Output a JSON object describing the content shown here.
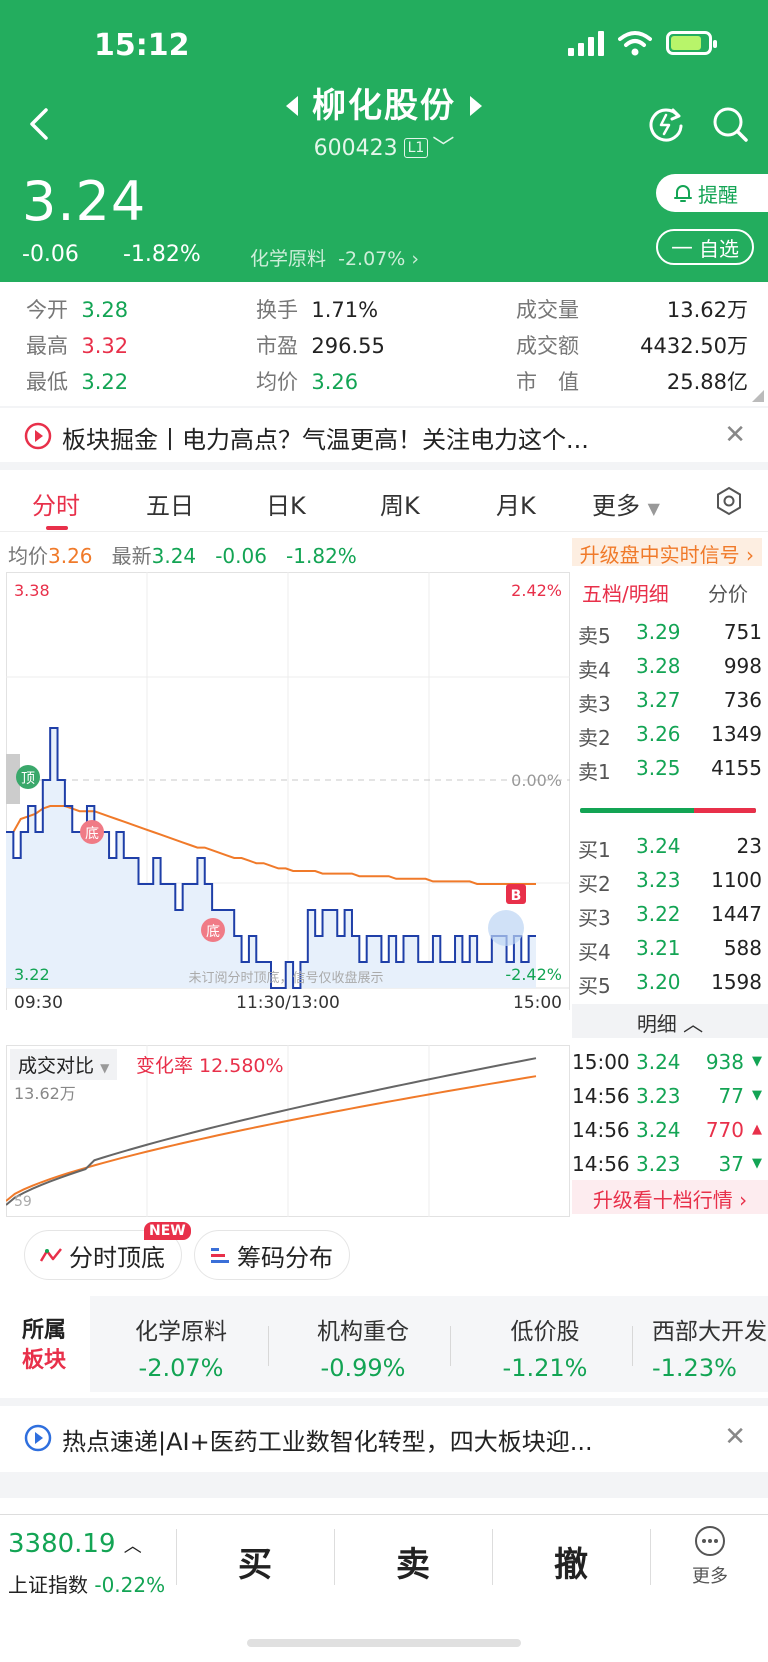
{
  "status": {
    "time": "15:12"
  },
  "header": {
    "stock_name": "柳化股份",
    "stock_code": "600423",
    "level": "L1",
    "price": "3.24",
    "change": "-0.06",
    "change_pct": "-1.82%",
    "sector_name": "化学原料",
    "sector_pct": "-2.07%",
    "alert_label": "提醒",
    "watch_label": "自选",
    "brand_color": "#23ad5e"
  },
  "stats": [
    {
      "label": "今开",
      "value": "3.28",
      "tone": "green"
    },
    {
      "label": "换手",
      "value": "1.71%",
      "tone": "black"
    },
    {
      "label": "成交量",
      "value": "13.62万",
      "tone": "black"
    },
    {
      "label": "最高",
      "value": "3.32",
      "tone": "red"
    },
    {
      "label": "市盈",
      "value": "296.55",
      "tone": "black"
    },
    {
      "label": "成交额",
      "value": "4432.50万",
      "tone": "black"
    },
    {
      "label": "最低",
      "value": "3.22",
      "tone": "green"
    },
    {
      "label": "均价",
      "value": "3.26",
      "tone": "green"
    },
    {
      "label": "市　值",
      "value": "25.88亿",
      "tone": "black"
    }
  ],
  "news1": "板块掘金丨电力高点？气温更高！关注电力这个...",
  "tabs": [
    "分时",
    "五日",
    "日K",
    "周K",
    "月K",
    "更多"
  ],
  "summary": {
    "avg_label": "均价",
    "avg_value": "3.26",
    "latest_label": "最新",
    "latest_value": "3.24",
    "change": "-0.06",
    "change_pct": "-1.82%",
    "upgrade": "升级盘中实时信号"
  },
  "chart": {
    "high_price": "3.38",
    "low_price": "3.22",
    "high_pct": "2.42%",
    "low_pct": "-2.42%",
    "zero_pct": "0.00%",
    "time_labels": [
      "09:30",
      "11:30/13:00",
      "15:00"
    ],
    "watermark": "未订阅分时顶底，信号仅收盘展示",
    "top_marker": "顶",
    "bottom_marker": "底",
    "buy_marker": "B"
  },
  "chart_data": {
    "type": "line",
    "ylim": [
      3.22,
      3.38
    ],
    "x": [
      "09:30",
      "11:30/13:00",
      "15:00"
    ],
    "series": [
      {
        "name": "价格",
        "values": [
          3.28,
          3.27,
          3.28,
          3.29,
          3.28,
          3.3,
          3.32,
          3.3,
          3.29,
          3.28,
          3.28,
          3.29,
          3.28,
          3.28,
          3.27,
          3.28,
          3.27,
          3.27,
          3.26,
          3.26,
          3.27,
          3.26,
          3.26,
          3.25,
          3.26,
          3.26,
          3.27,
          3.26,
          3.25,
          3.25,
          3.25,
          3.24,
          3.23,
          3.24,
          3.23,
          3.23,
          3.22,
          3.22,
          3.23,
          3.22,
          3.23,
          3.25,
          3.24,
          3.25,
          3.25,
          3.24,
          3.25,
          3.24,
          3.23,
          3.24,
          3.24,
          3.23,
          3.24,
          3.23,
          3.24,
          3.24,
          3.23,
          3.23,
          3.24,
          3.23,
          3.23,
          3.24,
          3.23,
          3.24,
          3.23,
          3.23,
          3.24,
          3.24,
          3.23,
          3.24,
          3.23,
          3.24,
          3.24
        ]
      },
      {
        "name": "均价",
        "values": [
          3.28,
          3.28,
          3.285,
          3.286,
          3.287,
          3.289,
          3.29,
          3.29,
          3.29,
          3.289,
          3.288,
          3.288,
          3.288,
          3.287,
          3.286,
          3.285,
          3.284,
          3.283,
          3.282,
          3.281,
          3.28,
          3.279,
          3.278,
          3.277,
          3.276,
          3.275,
          3.274,
          3.274,
          3.273,
          3.272,
          3.271,
          3.27,
          3.27,
          3.269,
          3.268,
          3.268,
          3.267,
          3.266,
          3.266,
          3.265,
          3.265,
          3.265,
          3.265,
          3.264,
          3.264,
          3.264,
          3.264,
          3.264,
          3.263,
          3.263,
          3.263,
          3.263,
          3.263,
          3.262,
          3.262,
          3.262,
          3.262,
          3.262,
          3.261,
          3.261,
          3.261,
          3.261,
          3.261,
          3.261,
          3.26,
          3.26,
          3.26,
          3.26,
          3.26,
          3.26,
          3.26,
          3.26,
          3.26
        ]
      }
    ]
  },
  "orderbook": {
    "tab1": "五档/明细",
    "tab2": "分价",
    "asks": [
      {
        "label": "卖5",
        "price": "3.29",
        "vol": "751"
      },
      {
        "label": "卖4",
        "price": "3.28",
        "vol": "998"
      },
      {
        "label": "卖3",
        "price": "3.27",
        "vol": "736"
      },
      {
        "label": "卖2",
        "price": "3.26",
        "vol": "1349"
      },
      {
        "label": "卖1",
        "price": "3.25",
        "vol": "4155"
      }
    ],
    "bids": [
      {
        "label": "买1",
        "price": "3.24",
        "vol": "23"
      },
      {
        "label": "买2",
        "price": "3.23",
        "vol": "1100"
      },
      {
        "label": "买3",
        "price": "3.22",
        "vol": "1447"
      },
      {
        "label": "买4",
        "price": "3.21",
        "vol": "588"
      },
      {
        "label": "买5",
        "price": "3.20",
        "vol": "1598"
      }
    ],
    "detail_label": "明细",
    "ticks": [
      {
        "time": "15:00",
        "price": "3.24",
        "vol": "938",
        "dir": "down"
      },
      {
        "time": "14:56",
        "price": "3.23",
        "vol": "77",
        "dir": "down"
      },
      {
        "time": "14:56",
        "price": "3.24",
        "vol": "770",
        "dir": "up"
      },
      {
        "time": "14:56",
        "price": "3.23",
        "vol": "37",
        "dir": "down"
      }
    ],
    "upgrade10": "升级看十档行情"
  },
  "volume": {
    "label": "成交对比",
    "rate": "变化率 12.580%",
    "max": "13.62万",
    "min": "59"
  },
  "chips": {
    "tops": "分时顶底",
    "chips": "筹码分布",
    "new_badge": "NEW"
  },
  "sectors": {
    "title1": "所属",
    "title2": "板块",
    "items": [
      {
        "name": "化学原料",
        "pct": "-2.07%"
      },
      {
        "name": "机构重仓",
        "pct": "-0.99%"
      },
      {
        "name": "低价股",
        "pct": "-1.21%"
      },
      {
        "name": "西部大开发",
        "pct": "-1.23%"
      }
    ]
  },
  "news2": "热点速递|AI+医药工业数智化转型，四大板块迎...",
  "bottom": {
    "index_value": "3380.19",
    "index_name": "上证指数",
    "index_pct": "-0.22%",
    "buy": "买",
    "sell": "卖",
    "cancel": "撤",
    "more": "更多"
  }
}
